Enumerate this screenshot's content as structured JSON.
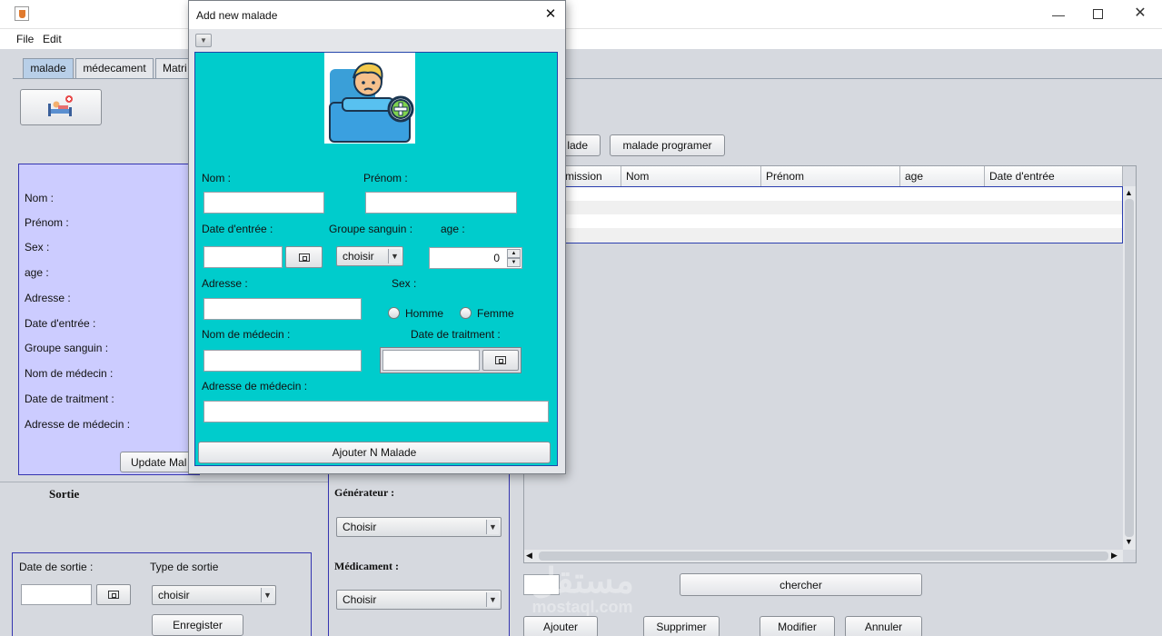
{
  "main_window": {
    "menu": {
      "file": "File",
      "edit": "Edit"
    },
    "tabs": [
      {
        "label": "malade"
      },
      {
        "label": "médecament"
      },
      {
        "label": "Matri"
      }
    ],
    "left_panel": {
      "labels": [
        "Nom :",
        "Prénom :",
        "Sex :",
        "age :",
        "Adresse :",
        "Date d'entrée :",
        "Groupe sanguin :",
        "Nom de médecin :",
        "Date de traitment  :",
        "Adresse de médecin :"
      ],
      "update_button": "Update Mal"
    },
    "sortie": {
      "title": "Sortie",
      "date_label": "Date de sortie :",
      "type_label": "Type de sortie",
      "type_value": "choisir",
      "save_button": "Enregister"
    },
    "middle": {
      "generateur_label": "Générateur :",
      "generateur_value": "Choisir",
      "medicament_label": "Médicament :",
      "medicament_value": "Choisir"
    },
    "right": {
      "btn_malade": "lade",
      "btn_programer": "malade programer",
      "columns": [
        "mission",
        "Nom",
        "Prénom",
        "age",
        "Date d'entrée"
      ],
      "search_button": "chercher",
      "add_button": "Ajouter",
      "delete_button": "Supprimer",
      "edit_button": "Modifier",
      "cancel_button": "Annuler"
    }
  },
  "dialog": {
    "title": "Add new malade",
    "labels": {
      "nom": "Nom :",
      "prenom": "Prénom :",
      "date_entree": "Date d'entrée :",
      "groupe": "Groupe sanguin :",
      "age": "age :",
      "adresse": "Adresse :",
      "sex": "Sex :",
      "homme": "Homme",
      "femme": "Femme",
      "nom_medecin": "Nom de médecin :",
      "date_traitement": "Date de traitment  :",
      "adresse_medecin": "Adresse de médecin :"
    },
    "groupe_value": "choisir",
    "age_value": "0",
    "submit_button": "Ajouter N Malade"
  },
  "colors": {
    "dialog_panel": "#00cccc",
    "left_panel": "#ccccff"
  }
}
